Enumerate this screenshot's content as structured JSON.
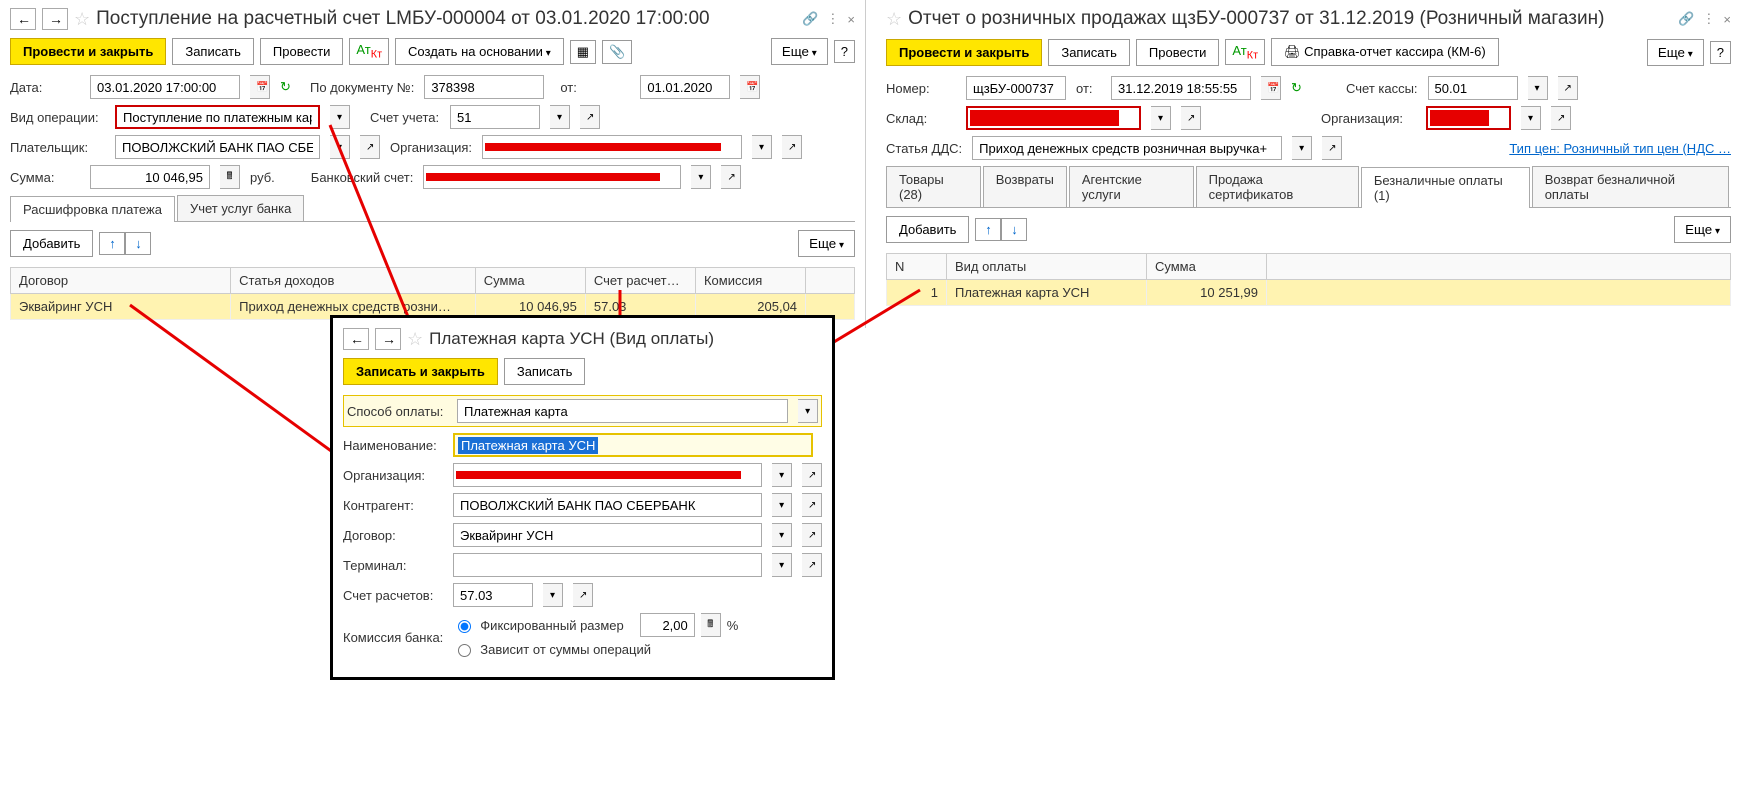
{
  "left": {
    "title": "Поступление на расчетный счет LМБУ-000004 от 03.01.2020 17:00:00",
    "toolbar": {
      "post_close": "Провести и закрыть",
      "record": "Записать",
      "post": "Провести",
      "create_based": "Создать на основании",
      "more": "Еще"
    },
    "date_label": "Дата:",
    "date_value": "03.01.2020 17:00:00",
    "docnum_label": "По документу №:",
    "docnum_value": "378398",
    "from_label": "от:",
    "from_value": "01.01.2020",
    "optype_label": "Вид операции:",
    "optype_value": "Поступление по платежным картам",
    "account_label": "Счет учета:",
    "account_value": "51",
    "payer_label": "Плательщик:",
    "payer_value": "ПОВОЛЖСКИЙ БАНК ПАО СБЕРБА",
    "org_label": "Организация:",
    "sum_label": "Сумма:",
    "sum_value": "10 046,95",
    "sum_cur": "руб.",
    "bank_label": "Банковский счет:",
    "tab_decode": "Расшифровка платежа",
    "tab_services": "Учет услуг банка",
    "add_btn": "Добавить",
    "more2": "Еще",
    "cols": {
      "contract": "Договор",
      "income": "Статья доходов",
      "sum": "Сумма",
      "settle_acc": "Счет расчет…",
      "commission": "Комиссия"
    },
    "row": {
      "contract": "Эквайринг УСН",
      "income": "Приход денежных средств розни…",
      "sum": "10 046,95",
      "settle_acc": "57.03",
      "commission": "205,04"
    }
  },
  "right": {
    "title": "Отчет о розничных продажах щзБУ-000737 от 31.12.2019 (Розничный магазин)",
    "toolbar": {
      "post_close": "Провести и закрыть",
      "record": "Записать",
      "post": "Провести",
      "km6": "Справка-отчет кассира (КМ-6)",
      "more": "Еще"
    },
    "num_label": "Номер:",
    "num_value": "щзБУ-000737",
    "from_label": "от:",
    "from_value": "31.12.2019 18:55:55",
    "cashacc_label": "Счет кассы:",
    "cashacc_value": "50.01",
    "warehouse_label": "Склад:",
    "org_label": "Организация:",
    "dds_label": "Статья ДДС:",
    "dds_value": "Приход денежных средств розничная выручка+",
    "price_type_link": "Тип цен: Розничный тип цен (НДС …",
    "tabs": {
      "goods": "Товары (28)",
      "returns": "Возвраты",
      "agent": "Агентские услуги",
      "certs": "Продажа сертификатов",
      "noncash": "Безналичные оплаты (1)",
      "ret_noncash": "Возврат безналичной оплаты"
    },
    "add_btn": "Добавить",
    "more2": "Еще",
    "cols": {
      "n": "N",
      "paytype": "Вид оплаты",
      "sum": "Сумма"
    },
    "row": {
      "n": "1",
      "paytype": "Платежная карта УСН",
      "sum": "10 251,99"
    }
  },
  "popup": {
    "title": "Платежная карта УСН (Вид оплаты)",
    "save_close": "Записать и закрыть",
    "save": "Записать",
    "method_label": "Способ оплаты:",
    "method_value": "Платежная карта",
    "name_label": "Наименование:",
    "name_value": "Платежная карта УСН",
    "org_label": "Организация:",
    "agent_label": "Контрагент:",
    "agent_value": "ПОВОЛЖСКИЙ БАНК ПАО СБЕРБАНК",
    "contract_label": "Договор:",
    "contract_value": "Эквайринг УСН",
    "terminal_label": "Терминал:",
    "settleacc_label": "Счет расчетов:",
    "settleacc_value": "57.03",
    "commission_label": "Комиссия банка:",
    "fixed": "Фиксированный размер",
    "fixed_val": "2,00",
    "percent": "%",
    "depends": "Зависит от суммы операций"
  }
}
